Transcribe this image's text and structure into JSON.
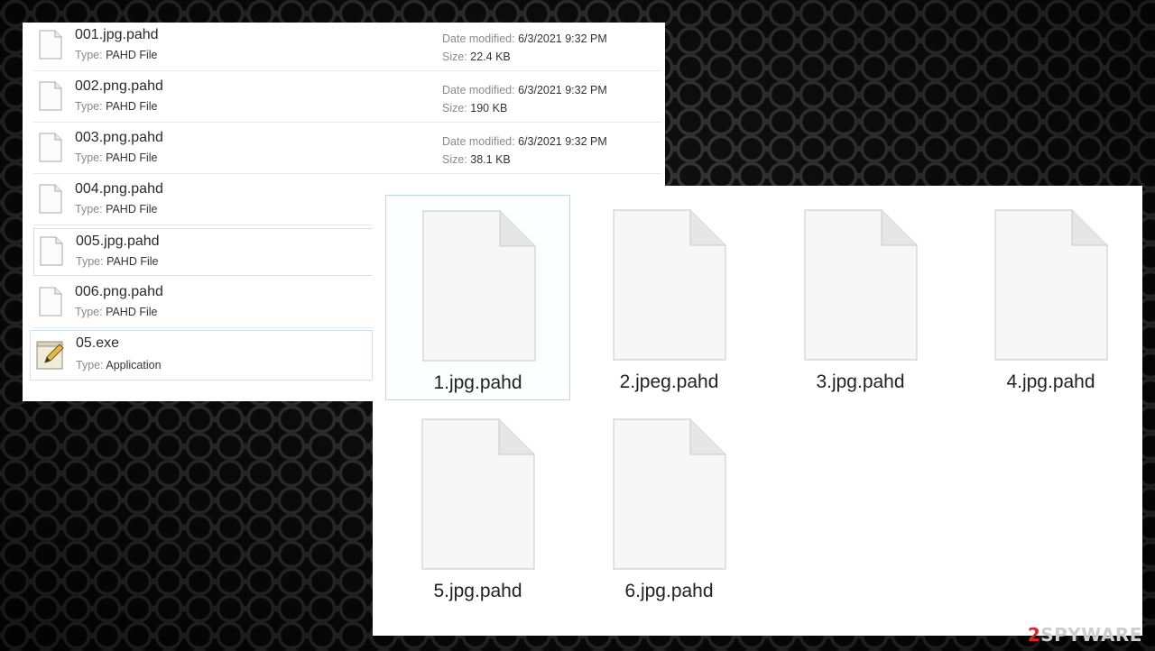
{
  "details_list": {
    "date_label": "Date modified:",
    "size_label": "Size:",
    "type_label": "Type:",
    "items": [
      {
        "name": "001.jpg.pahd",
        "type": "PAHD File",
        "date": "6/3/2021 9:32 PM",
        "size": "22.4 KB"
      },
      {
        "name": "002.png.pahd",
        "type": "PAHD File",
        "date": "6/3/2021 9:32 PM",
        "size": "190 KB"
      },
      {
        "name": "003.png.pahd",
        "type": "PAHD File",
        "date": "6/3/2021 9:32 PM",
        "size": "38.1 KB"
      },
      {
        "name": "004.png.pahd",
        "type": "PAHD File"
      },
      {
        "name": "005.jpg.pahd",
        "type": "PAHD File"
      },
      {
        "name": "006.png.pahd",
        "type": "PAHD File"
      },
      {
        "name": "05.exe",
        "type": "Application",
        "icon": "application-edit-icon"
      }
    ]
  },
  "large_icons": {
    "items": [
      {
        "name": "1.jpg.pahd"
      },
      {
        "name": "2.jpeg.pahd"
      },
      {
        "name": "3.jpg.pahd"
      },
      {
        "name": "4.jpg.pahd"
      },
      {
        "name": "5.jpg.pahd"
      },
      {
        "name": "6.jpg.pahd"
      }
    ]
  },
  "watermark": {
    "number": "2",
    "text": "SPYWAR",
    "suffix": "E"
  },
  "colors": {
    "selection_border": "#b7d6ef",
    "watermark_red": "#d9252b"
  }
}
